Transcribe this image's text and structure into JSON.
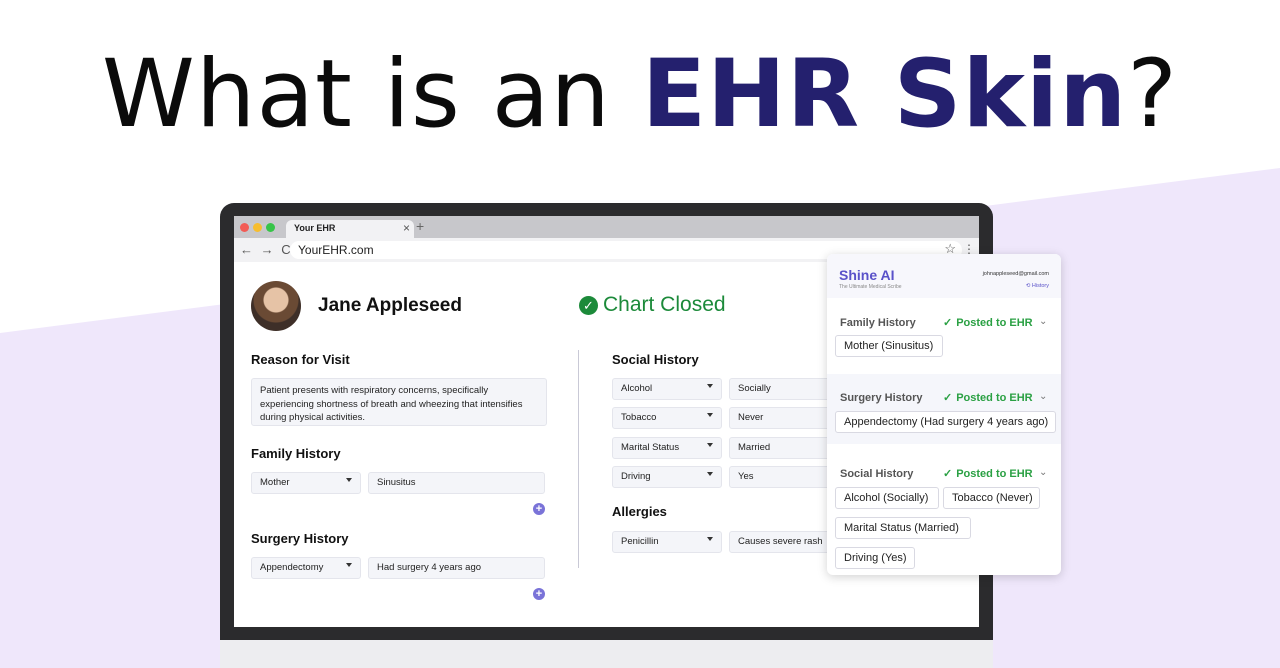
{
  "headline": {
    "prefix": "What is an ",
    "accent": "EHR Skin",
    "suffix": "?"
  },
  "browser": {
    "tab_title": "Your EHR",
    "tab_close": "×",
    "new_tab": "+",
    "nav": "← → C",
    "url": "YourEHR.com"
  },
  "ehr": {
    "patient_name": "Jane Appleseed",
    "chart_status": "Chart Closed",
    "reason_title": "Reason for Visit",
    "reason_text": "Patient presents with respiratory concerns, specifically experiencing shortness of breath and wheezing that intensifies during physical activities.",
    "family_title": "Family History",
    "family_rows": [
      {
        "select": "Mother",
        "value": "Sinusitus"
      }
    ],
    "surgery_title": "Surgery History",
    "surgery_rows": [
      {
        "select": "Appendectomy",
        "value": "Had surgery 4 years ago"
      }
    ],
    "social_title": "Social History",
    "social_rows": [
      {
        "select": "Alcohol",
        "value": "Socially"
      },
      {
        "select": "Tobacco",
        "value": "Never"
      },
      {
        "select": "Marital Status",
        "value": "Married"
      },
      {
        "select": "Driving",
        "value": "Yes"
      }
    ],
    "allergies_title": "Allergies",
    "allergy_rows": [
      {
        "select": "Penicillin",
        "value": "Causes severe rash"
      }
    ],
    "add_glyph": "+"
  },
  "shine": {
    "title": "Shine AI",
    "tagline": "The Ultimate Medical Scribe",
    "email": "johnappleseed@gmail.com",
    "history": "History",
    "posted_label": "Posted to EHR",
    "sections": [
      {
        "title": "Family History",
        "chips": [
          "Mother (Sinusitus)"
        ]
      },
      {
        "title": "Surgery History",
        "chips": [
          "Appendectomy (Had surgery 4 years ago)"
        ]
      },
      {
        "title": "Social History",
        "chips": [
          "Alcohol (Socially)",
          "Tobacco (Never)",
          "Marital Status (Married)",
          "Driving (Yes)"
        ]
      }
    ]
  },
  "colors": {
    "accent": "#24206e",
    "shine_purple": "#5a52c9",
    "posted_green": "#2aa043",
    "chart_green": "#1c8a3a",
    "wedge_lavender": "#efe7fb"
  },
  "icons": {
    "check": "check-icon",
    "chevron": "chevron-down-icon",
    "star": "star-icon",
    "add": "plus-circle-icon"
  }
}
